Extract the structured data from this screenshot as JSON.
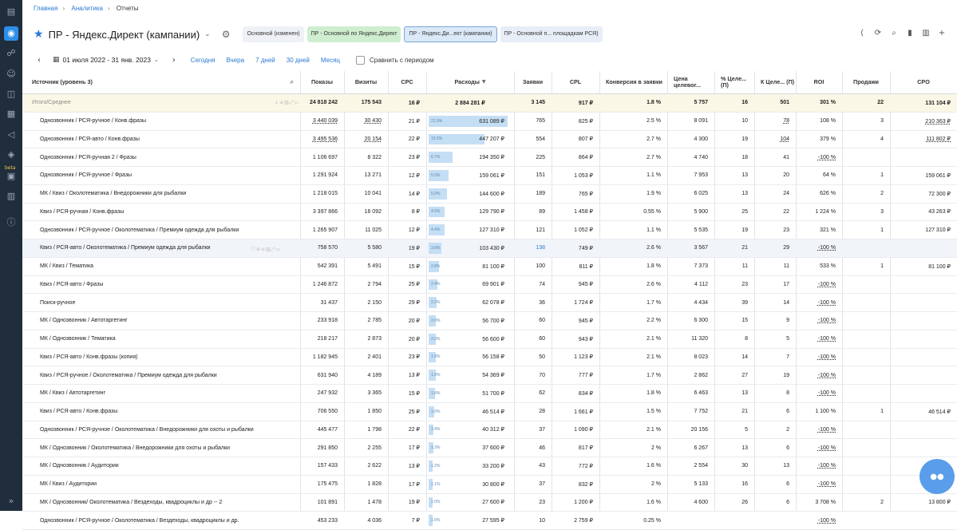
{
  "breadcrumb": [
    "Главная",
    "Аналитика",
    "Отчеты"
  ],
  "report": {
    "title": "ПР - Яндекс.Директ (кампании)",
    "tags": [
      "Основной (изменен)",
      "ПР - Основной по Яндекс.Директ",
      "ПР - Яндекс.Ди...ект (кампании)",
      "ПР - Основной п... площадкам РСЯ)"
    ]
  },
  "toolbar_icons": [
    "share-icon",
    "refresh-icon",
    "search-icon",
    "chart-icon",
    "columns-icon",
    "add-icon"
  ],
  "datebar": {
    "range": "01 июля 2022 - 31 янв. 2023",
    "quick": [
      "Сегодня",
      "Вчера",
      "7 дней",
      "30 дней",
      "Месяц"
    ],
    "compare_label": "Сравнить с периодом"
  },
  "colors": {
    "accent": "#2a7bd1",
    "bar": "#c4def4",
    "sidebar": "#1f2d3d",
    "total_row": "#fbf7e6"
  },
  "table": {
    "headers": [
      "Источник (уровень 3)",
      "Показы",
      "Визиты",
      "CPC",
      "Расходы",
      "Заявки",
      "CPL",
      "Конверсия в заявки",
      "Цена целевог...",
      "% Целе... (П)",
      "К Целе... (П)",
      "ROI",
      "Продажи",
      "CPO"
    ],
    "total": [
      "Итого/Среднее",
      "24 818 242",
      "175 543",
      "16 ₽",
      "2 884 281 ₽",
      "3 145",
      "917 ₽",
      "1.8 %",
      "5 757",
      "16",
      "501",
      "301 %",
      "22",
      "131 104 ₽"
    ],
    "rows": [
      {
        "name": "Однозвонник / РСЯ-ручное / Конв.фразы",
        "impressions": "3 440 039",
        "visits": "30 430",
        "cpc": "21 ₽",
        "spend_pct": "21.9%",
        "spend_share": 21.9,
        "spend": "631 089 ₽",
        "leads": "765",
        "cpl": "825 ₽",
        "conv": "2.5 %",
        "target_price": "8 091",
        "pct_target": "10",
        "k_target": "78",
        "roi": "108 %",
        "sales": "3",
        "cpo": "210 363 ₽"
      },
      {
        "name": "Однозвонник / РСЯ-авто / Конв.фразы",
        "impressions": "3 495 536",
        "visits": "20 154",
        "cpc": "22 ₽",
        "spend_pct": "15.5%",
        "spend_share": 15.5,
        "spend": "447 207 ₽",
        "leads": "554",
        "cpl": "807 ₽",
        "conv": "2.7 %",
        "target_price": "4 300",
        "pct_target": "19",
        "k_target": "104",
        "roi": "379 %",
        "sales": "4",
        "cpo": "111 802 ₽"
      },
      {
        "name": "Однозвонник / РСЯ-ручная 2 / Фразы",
        "impressions": "1 106 697",
        "visits": "8 322",
        "cpc": "23 ₽",
        "spend_pct": "6.7%",
        "spend_share": 6.7,
        "spend": "194 350 ₽",
        "leads": "225",
        "cpl": "864 ₽",
        "conv": "2.7 %",
        "target_price": "4 740",
        "pct_target": "18",
        "k_target": "41",
        "roi": "-100 %",
        "sales": "",
        "cpo": ""
      },
      {
        "name": "Однозвонник / РСЯ-ручное / Фразы",
        "impressions": "1 291 924",
        "visits": "13 271",
        "cpc": "12 ₽",
        "spend_pct": "5.5%",
        "spend_share": 5.5,
        "spend": "159 061 ₽",
        "leads": "151",
        "cpl": "1 053 ₽",
        "conv": "1.1 %",
        "target_price": "7 953",
        "pct_target": "13",
        "k_target": "20",
        "roi": "64 %",
        "sales": "1",
        "cpo": "159 061 ₽"
      },
      {
        "name": "МК / Квиз / Околотематика / Внедорожники для рыбалки",
        "impressions": "1 218 015",
        "visits": "10 041",
        "cpc": "14 ₽",
        "spend_pct": "5.0%",
        "spend_share": 5.0,
        "spend": "144 600 ₽",
        "leads": "189",
        "cpl": "765 ₽",
        "conv": "1.9 %",
        "target_price": "6 025",
        "pct_target": "13",
        "k_target": "24",
        "roi": "626 %",
        "sales": "2",
        "cpo": "72 300 ₽"
      },
      {
        "name": "Квиз / РСЯ-ручная / Конв.фразы",
        "impressions": "3 397 866",
        "visits": "16 092",
        "cpc": "8 ₽",
        "spend_pct": "4.5%",
        "spend_share": 4.5,
        "spend": "129 790 ₽",
        "leads": "89",
        "cpl": "1 458 ₽",
        "conv": "0.55 %",
        "target_price": "5 900",
        "pct_target": "25",
        "k_target": "22",
        "roi": "1 224 %",
        "sales": "3",
        "cpo": "43 263 ₽"
      },
      {
        "name": "Однозвонник / РСЯ-ручное / Околотематика / Премиум одежда для рыбалки",
        "impressions": "1 265 907",
        "visits": "11 025",
        "cpc": "12 ₽",
        "spend_pct": "4.4%",
        "spend_share": 4.4,
        "spend": "127 310 ₽",
        "leads": "121",
        "cpl": "1 052 ₽",
        "conv": "1.1 %",
        "target_price": "5 535",
        "pct_target": "19",
        "k_target": "23",
        "roi": "321 %",
        "sales": "1",
        "cpo": "127 310 ₽"
      },
      {
        "name": "Квиз / РСЯ-авто / Околотематика / Премиум одежда для рыбалки",
        "impressions": "758 570",
        "visits": "5 580",
        "cpc": "19 ₽",
        "spend_pct": "3.6%",
        "spend_share": 3.6,
        "spend": "103 430 ₽",
        "leads": "138",
        "cpl": "749 ₽",
        "conv": "2.6 %",
        "target_price": "3 567",
        "pct_target": "21",
        "k_target": "29",
        "roi": "-100 %",
        "sales": "",
        "cpo": ""
      },
      {
        "name": "МК / Квиз / Тематика",
        "impressions": "542 391",
        "visits": "5 491",
        "cpc": "15 ₽",
        "spend_pct": "2.8%",
        "spend_share": 2.8,
        "spend": "81 100 ₽",
        "leads": "100",
        "cpl": "811 ₽",
        "conv": "1.8 %",
        "target_price": "7 373",
        "pct_target": "11",
        "k_target": "11",
        "roi": "533 %",
        "sales": "1",
        "cpo": "81 100 ₽"
      },
      {
        "name": "Квиз / РСЯ-авто / Фразы",
        "impressions": "1 246 872",
        "visits": "2 794",
        "cpc": "25 ₽",
        "spend_pct": "2.4%",
        "spend_share": 2.4,
        "spend": "69 901 ₽",
        "leads": "74",
        "cpl": "945 ₽",
        "conv": "2.6 %",
        "target_price": "4 112",
        "pct_target": "23",
        "k_target": "17",
        "roi": "-100 %",
        "sales": "",
        "cpo": ""
      },
      {
        "name": "Поиск-ручное",
        "impressions": "31 437",
        "visits": "2 150",
        "cpc": "29 ₽",
        "spend_pct": "2.2%",
        "spend_share": 2.2,
        "spend": "62 078 ₽",
        "leads": "36",
        "cpl": "1 724 ₽",
        "conv": "1.7 %",
        "target_price": "4 434",
        "pct_target": "39",
        "k_target": "14",
        "roi": "-100 %",
        "sales": "",
        "cpo": ""
      },
      {
        "name": "МК / Однозвонник / Автотаргетинг",
        "impressions": "233 918",
        "visits": "2 785",
        "cpc": "20 ₽",
        "spend_pct": "2.0%",
        "spend_share": 2.0,
        "spend": "56 700 ₽",
        "leads": "60",
        "cpl": "945 ₽",
        "conv": "2.2 %",
        "target_price": "6 300",
        "pct_target": "15",
        "k_target": "9",
        "roi": "-100 %",
        "sales": "",
        "cpo": ""
      },
      {
        "name": "МК / Однозвонник / Тематика",
        "impressions": "218 217",
        "visits": "2 873",
        "cpc": "20 ₽",
        "spend_pct": "2.0%",
        "spend_share": 2.0,
        "spend": "56 600 ₽",
        "leads": "60",
        "cpl": "943 ₽",
        "conv": "2.1 %",
        "target_price": "11 320",
        "pct_target": "8",
        "k_target": "5",
        "roi": "-100 %",
        "sales": "",
        "cpo": ""
      },
      {
        "name": "Квиз / РСЯ-авто / Конв.фразы (копия)",
        "impressions": "1 182 945",
        "visits": "2 401",
        "cpc": "23 ₽",
        "spend_pct": "1.9%",
        "spend_share": 1.9,
        "spend": "56 158 ₽",
        "leads": "50",
        "cpl": "1 123 ₽",
        "conv": "2.1 %",
        "target_price": "8 023",
        "pct_target": "14",
        "k_target": "7",
        "roi": "-100 %",
        "sales": "",
        "cpo": ""
      },
      {
        "name": "Квиз / РСЯ-ручное / Околотематика / Премиум одежда для рыбалки",
        "impressions": "631 940",
        "visits": "4 189",
        "cpc": "13 ₽",
        "spend_pct": "1.9%",
        "spend_share": 1.9,
        "spend": "54 369 ₽",
        "leads": "70",
        "cpl": "777 ₽",
        "conv": "1.7 %",
        "target_price": "2 862",
        "pct_target": "27",
        "k_target": "19",
        "roi": "-100 %",
        "sales": "",
        "cpo": ""
      },
      {
        "name": "МК / Квиз / Автотаргетинг",
        "impressions": "247 932",
        "visits": "3 365",
        "cpc": "15 ₽",
        "spend_pct": "1.8%",
        "spend_share": 1.8,
        "spend": "51 700 ₽",
        "leads": "62",
        "cpl": "834 ₽",
        "conv": "1.8 %",
        "target_price": "6 463",
        "pct_target": "13",
        "k_target": "8",
        "roi": "-100 %",
        "sales": "",
        "cpo": ""
      },
      {
        "name": "Квиз / РСЯ-авто / Конв.фразы",
        "impressions": "706 550",
        "visits": "1 850",
        "cpc": "25 ₽",
        "spend_pct": "1.6%",
        "spend_share": 1.6,
        "spend": "46 514 ₽",
        "leads": "28",
        "cpl": "1 661 ₽",
        "conv": "1.5 %",
        "target_price": "7 752",
        "pct_target": "21",
        "k_target": "6",
        "roi": "1 100 %",
        "sales": "1",
        "cpo": "46 514 ₽"
      },
      {
        "name": "Однозвонник / РСЯ-ручное / Околотематика / Внедорожники для охоты и рыбалки",
        "impressions": "445 477",
        "visits": "1 798",
        "cpc": "22 ₽",
        "spend_pct": "1.4%",
        "spend_share": 1.4,
        "spend": "40 312 ₽",
        "leads": "37",
        "cpl": "1 090 ₽",
        "conv": "2.1 %",
        "target_price": "20 156",
        "pct_target": "5",
        "k_target": "2",
        "roi": "-100 %",
        "sales": "",
        "cpo": ""
      },
      {
        "name": "МК / Однозвонник / Околотематика / Внедорожники для охоты и рыбалки",
        "impressions": "291 850",
        "visits": "2 255",
        "cpc": "17 ₽",
        "spend_pct": "1.3%",
        "spend_share": 1.3,
        "spend": "37 600 ₽",
        "leads": "46",
        "cpl": "817 ₽",
        "conv": "2 %",
        "target_price": "6 267",
        "pct_target": "13",
        "k_target": "6",
        "roi": "-100 %",
        "sales": "",
        "cpo": ""
      },
      {
        "name": "МК / Однозвонник / Аудитории",
        "impressions": "157 433",
        "visits": "2 622",
        "cpc": "13 ₽",
        "spend_pct": "1.2%",
        "spend_share": 1.2,
        "spend": "33 200 ₽",
        "leads": "43",
        "cpl": "772 ₽",
        "conv": "1.6 %",
        "target_price": "2 554",
        "pct_target": "30",
        "k_target": "13",
        "roi": "-100 %",
        "sales": "",
        "cpo": ""
      },
      {
        "name": "МК / Квиз / Аудитории",
        "impressions": "175 475",
        "visits": "1 828",
        "cpc": "17 ₽",
        "spend_pct": "1.1%",
        "spend_share": 1.1,
        "spend": "30 800 ₽",
        "leads": "37",
        "cpl": "832 ₽",
        "conv": "2 %",
        "target_price": "5 133",
        "pct_target": "16",
        "k_target": "6",
        "roi": "-100 %",
        "sales": "",
        "cpo": ""
      },
      {
        "name": "МК / Однозвонник/ Околотематика / Вездеходы, квадроциклы и др -- 2",
        "impressions": "101 891",
        "visits": "1 478",
        "cpc": "19 ₽",
        "spend_pct": "1.0%",
        "spend_share": 1.0,
        "spend": "27 600 ₽",
        "leads": "23",
        "cpl": "1 200 ₽",
        "conv": "1.6 %",
        "target_price": "4 600",
        "pct_target": "26",
        "k_target": "6",
        "roi": "3 708 %",
        "sales": "2",
        "cpo": "13 800 ₽"
      },
      {
        "name": "Однозвонник / РСЯ-ручное / Околотематика / Вездеходы, квадроциклы и др.",
        "impressions": "453 233",
        "visits": "4 036",
        "cpc": "7 ₽",
        "spend_pct": "1.0%",
        "spend_share": 1.0,
        "spend": "27 595 ₽",
        "leads": "10",
        "cpl": "2 759 ₽",
        "conv": "0.25 %",
        "target_price": "",
        "pct_target": "",
        "k_target": "",
        "roi": "-100 %",
        "sales": "",
        "cpo": ""
      }
    ]
  }
}
